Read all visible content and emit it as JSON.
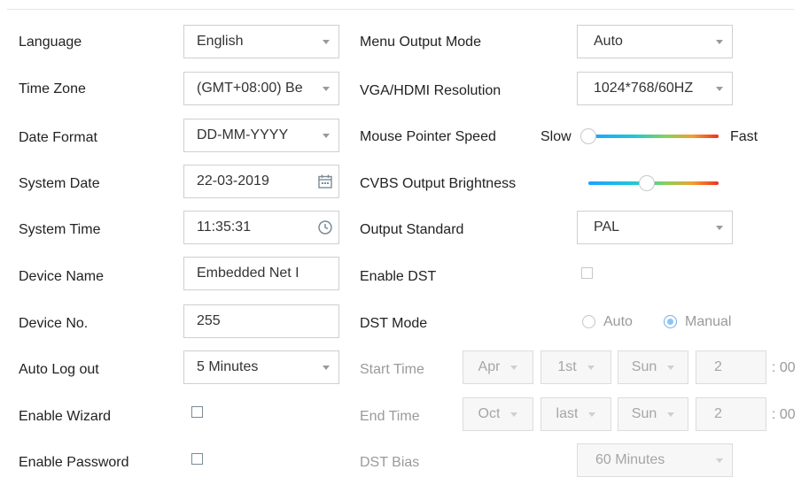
{
  "left": {
    "language": {
      "label": "Language",
      "value": "English"
    },
    "time_zone": {
      "label": "Time Zone",
      "value": "(GMT+08:00) Be"
    },
    "date_format": {
      "label": "Date Format",
      "value": "DD-MM-YYYY"
    },
    "system_date": {
      "label": "System Date",
      "value": "22-03-2019"
    },
    "system_time": {
      "label": "System Time",
      "value": "11:35:31"
    },
    "device_name": {
      "label": "Device Name",
      "value": "Embedded Net I"
    },
    "device_no": {
      "label": "Device No.",
      "value": "255"
    },
    "auto_logout": {
      "label": "Auto Log out",
      "value": "5 Minutes"
    },
    "enable_wizard": {
      "label": "Enable Wizard",
      "checked": false
    },
    "enable_password": {
      "label": "Enable Password",
      "checked": false
    }
  },
  "right": {
    "menu_output_mode": {
      "label": "Menu Output Mode",
      "value": "Auto"
    },
    "vga_hdmi_resolution": {
      "label": "VGA/HDMI Resolution",
      "value": "1024*768/60HZ"
    },
    "mouse_pointer_speed": {
      "label": "Mouse Pointer Speed",
      "min_label": "Slow",
      "max_label": "Fast",
      "level": 0.0
    },
    "cvbs_output_brightness": {
      "label": "CVBS Output Brightness",
      "level": 0.45
    },
    "output_standard": {
      "label": "Output Standard",
      "value": "PAL"
    },
    "enable_dst": {
      "label": "Enable DST",
      "checked": false
    },
    "dst_mode": {
      "label": "DST Mode",
      "options": [
        "Auto",
        "Manual"
      ],
      "selected": "Manual"
    },
    "start_time": {
      "label": "Start Time",
      "month": "Apr",
      "week": "1st",
      "day": "Sun",
      "hour": "2",
      "suffix": ": 00"
    },
    "end_time": {
      "label": "End Time",
      "month": "Oct",
      "week": "last",
      "day": "Sun",
      "hour": "2",
      "suffix": ": 00"
    },
    "dst_bias": {
      "label": "DST Bias",
      "value": "60 Minutes"
    }
  },
  "icons": {
    "calendar": "calendar-icon",
    "clock": "clock-icon",
    "dropdown": "chevron-down-icon"
  },
  "colors": {
    "slider_start": "#1ea0ff",
    "slider_end": "#f03020",
    "radio_selected": "#8fc3f2"
  }
}
